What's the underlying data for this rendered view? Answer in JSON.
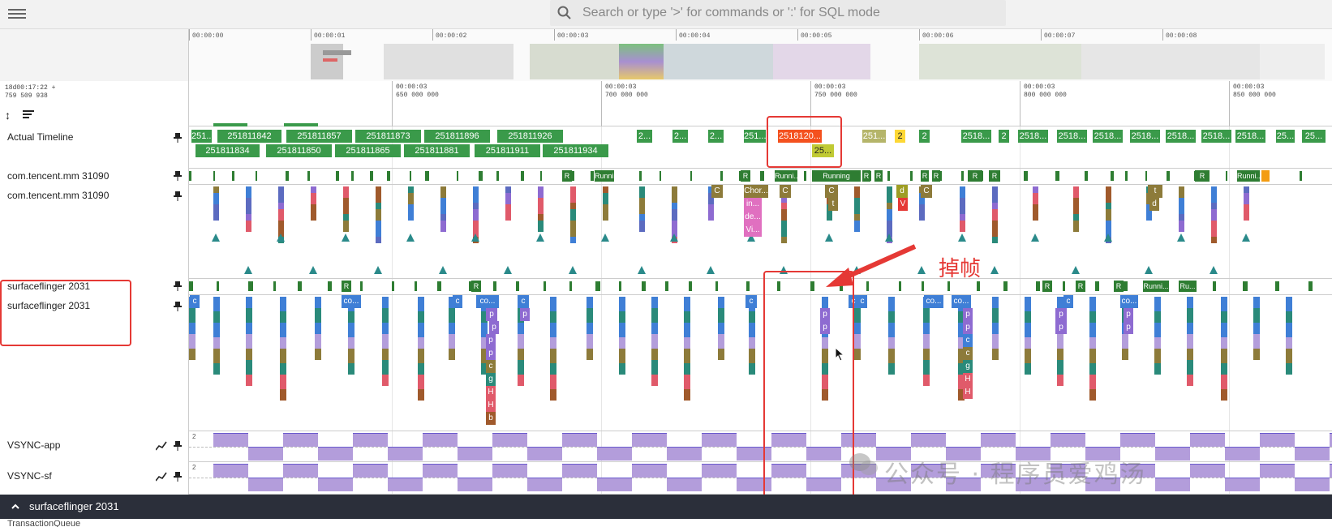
{
  "search": {
    "placeholder": "Search or type '>' for commands or ':' for SQL mode"
  },
  "overview": {
    "ticks": [
      "00:00:00",
      "00:00:01",
      "00:00:02",
      "00:00:03",
      "00:00:04",
      "00:00:05",
      "00:00:06",
      "00:00:07",
      "00:00:08"
    ]
  },
  "ruler": {
    "timestamp_line1": "18d00:17:22 +",
    "timestamp_line2": "759 509 938",
    "ticks": [
      {
        "l1": "00:00:03",
        "l2": "650 000 000"
      },
      {
        "l1": "00:00:03",
        "l2": "700 000 000"
      },
      {
        "l1": "00:00:03",
        "l2": "750 000 000"
      },
      {
        "l1": "00:00:03",
        "l2": "800 000 000"
      },
      {
        "l1": "00:00:03",
        "l2": "850 000 000"
      }
    ]
  },
  "tracks": {
    "actual_timeline": "Actual Timeline",
    "app_thread_summary": "com.tencent.mm 31090",
    "app_thread": "com.tencent.mm 31090",
    "sf_summary": "surfaceflinger 2031",
    "sf_thread": "surfaceflinger 2031",
    "vsync_app": "VSYNC-app",
    "vsync_sf": "VSYNC-sf",
    "vsync_value": "2"
  },
  "actual_timeline": {
    "row1": [
      "251...",
      "251811842",
      "251811857",
      "251811873",
      "251811896",
      "251811926",
      "2...",
      "2...",
      "2...",
      "251...",
      "2518120...",
      "251...",
      "2",
      "2",
      "2518...",
      "2",
      "2518...",
      "2518...",
      "2518...",
      "2518...",
      "2518...",
      "2518...",
      "2518...",
      "25...",
      "25..."
    ],
    "row2": [
      "251811834",
      "251811850",
      "251811865",
      "251811881",
      "251811911",
      "251811934",
      "25..."
    ]
  },
  "app_slices": {
    "running": "Running",
    "running_short": "Runni...",
    "r": "R"
  },
  "app_thread_labels": [
    "C",
    "Chor...",
    "in...",
    "de...",
    "Vi...",
    "C",
    "C",
    "t",
    "d",
    "V",
    "C",
    "t",
    "d"
  ],
  "sf_summary_labels": [
    "R",
    "R",
    "R",
    "R",
    "R",
    "Runni...",
    "Ru..."
  ],
  "sf_thread_labels": [
    "c",
    "co...",
    "c",
    "p",
    "p",
    "co...",
    "c",
    "p",
    "p",
    "p",
    "c",
    "g",
    "H",
    "H",
    "b",
    "c",
    "c",
    "c",
    "p",
    "p",
    "co...",
    "co...",
    "p",
    "p",
    "c",
    "c",
    "g",
    "H",
    "H",
    "c",
    "p",
    "p",
    "co...",
    "p",
    "p"
  ],
  "annotation": {
    "drop_label": "掉帧"
  },
  "bottom": {
    "title": "surfaceflinger 2031",
    "next_row": "TransactionQueue"
  },
  "watermark": "公众号 · 程序员爱鸡汤",
  "colors": {
    "slice_green": "#3a9a4a",
    "slice_orange": "#f4511e",
    "slice_yellow": "#fdd835",
    "slice_olive": "#c0ca33",
    "vsync_purple": "#b39ddb",
    "highlight_red": "#e53935",
    "bottombar_bg": "#2b2f3a"
  }
}
